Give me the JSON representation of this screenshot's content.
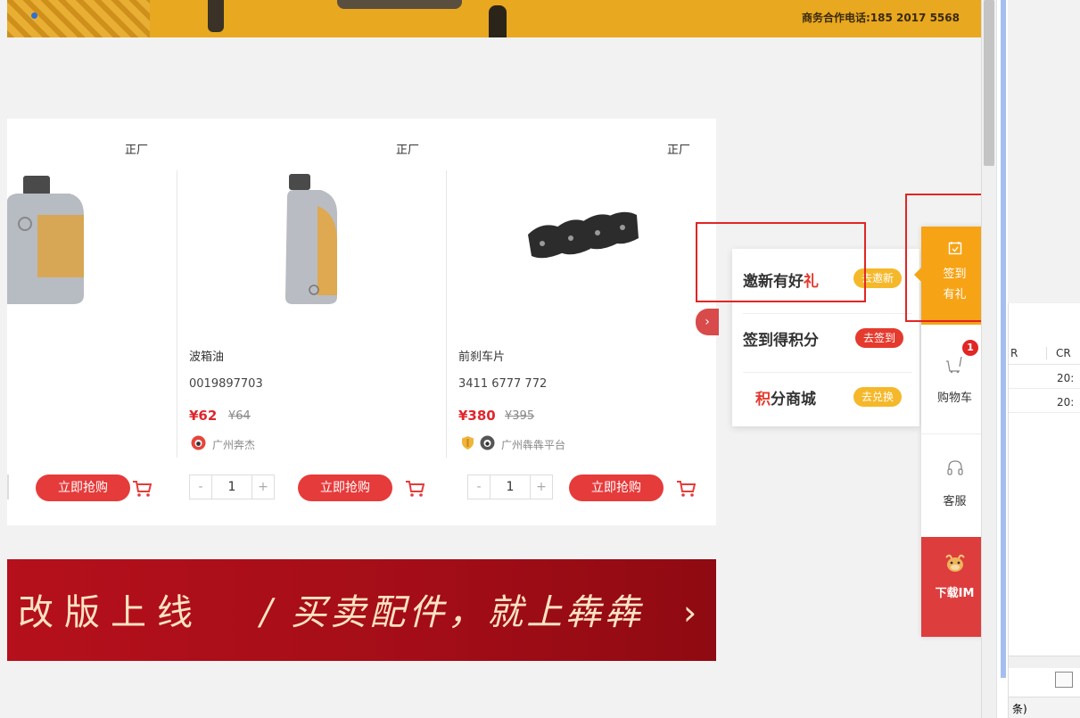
{
  "top_banner": {
    "phone_text": "商务合作电话:185 2017 5568"
  },
  "products": [
    {
      "tag": "正厂",
      "buy_label": "立即抢购"
    },
    {
      "tag": "正厂",
      "name": "波箱油",
      "code": "0019897703",
      "price": "¥62",
      "old_price": "¥64",
      "store": "广州奔杰",
      "quantity": "1",
      "minus": "-",
      "plus": "+",
      "buy_label": "立即抢购"
    },
    {
      "tag": "正厂",
      "name": "前刹车片",
      "code": "3411 6777 772",
      "price": "¥380",
      "old_price": "¥395",
      "store": "广州犇犇平台",
      "quantity": "1",
      "minus": "-",
      "plus": "+",
      "buy_label": "立即抢购"
    }
  ],
  "carousel": {
    "next_glyph": "›"
  },
  "red_banner": {
    "text_left": "改版上线",
    "text_right": "/ 买卖配件，就上犇犇",
    "arrow": "›"
  },
  "popup": {
    "rows": [
      {
        "label_pre": "邀新有好",
        "label_hl": "礼",
        "action": "去邀新",
        "action_color": "#f5b82a"
      },
      {
        "label_pre": "签到得积分",
        "label_hl": "",
        "action": "去签到",
        "action_color": "#e53a2e"
      },
      {
        "label_pre": "",
        "label_hl": "积",
        "label_post": "分商城",
        "action": "去兑换",
        "action_color": "#f5b82a"
      }
    ]
  },
  "sidebar": {
    "sign_in": "签到\n有礼",
    "sign_in_line1": "签到",
    "sign_in_line2": "有礼",
    "cart_label": "购物车",
    "cart_badge": "1",
    "service_label": "客服",
    "download_label": "下载IM"
  },
  "side_app": {
    "headers": [
      "R",
      "CR"
    ],
    "rows": [
      [
        "",
        "20:"
      ],
      [
        "",
        "20:"
      ]
    ],
    "footer_text": "条)"
  },
  "colors": {
    "accent_red": "#e63b3b",
    "sign_orange": "#f6a316",
    "highlight_box": "#e32424"
  }
}
